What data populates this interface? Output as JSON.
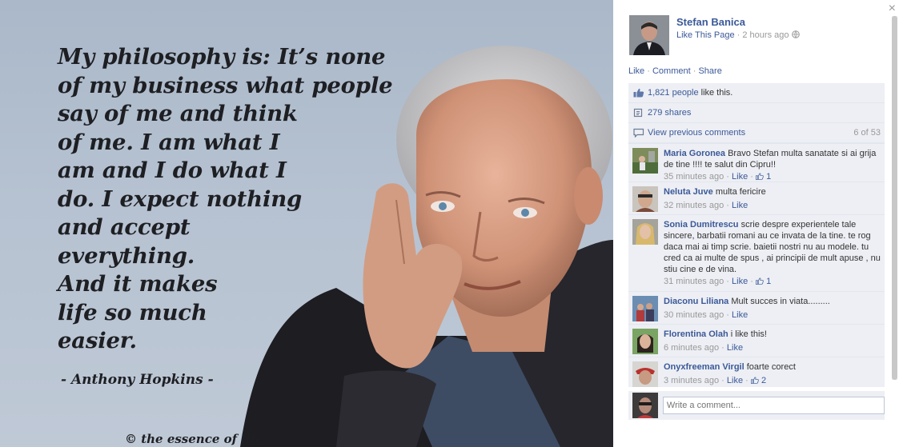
{
  "photo": {
    "quote_lines": [
      "My philosophy is: It’s none",
      "of my business what people",
      "say of me and think",
      "of me. I am what I",
      "am and I do what I",
      "do. I expect nothing",
      "and accept",
      "everything.",
      "And it makes",
      "life so much",
      "easier."
    ],
    "author": "- Anthony Hopkins -",
    "copyright": "© the essence of life"
  },
  "panel": {
    "close_glyph": "×",
    "page_name": "Stefan Banica",
    "like_page": "Like This Page",
    "separator": "·",
    "time": "2 hours ago",
    "actions": {
      "like": "Like",
      "comment": "Comment",
      "share": "Share"
    },
    "likes": {
      "link": "1,821 people",
      "rest": "like this."
    },
    "shares": "279 shares",
    "previous": {
      "label": "View previous comments",
      "count": "6 of 53"
    },
    "comments": [
      {
        "name": "Maria Goronea",
        "text": "Bravo Stefan multa sanatate si ai grija de tine !!!! te salut din Cipru!!",
        "time": "35 minutes ago",
        "like": "Like",
        "likes": "1"
      },
      {
        "name": "Neluta Juve",
        "text": "multa fericire",
        "time": "32 minutes ago",
        "like": "Like",
        "likes": ""
      },
      {
        "name": "Sonia Dumitrescu",
        "text": "scrie despre experientele tale sincere, barbatii romani au ce invata de la tine. te rog daca mai ai timp scrie. baietii nostri nu au modele. tu cred ca ai multe de spus , ai principii de mult apuse , nu stiu cine e de vina.",
        "time": "31 minutes ago",
        "like": "Like",
        "likes": "1"
      },
      {
        "name": "Diaconu Liliana",
        "text": "Mult succes in viata.........",
        "time": "30 minutes ago",
        "like": "Like",
        "likes": ""
      },
      {
        "name": "Florentina Olah",
        "text": "i like this!",
        "time": "6 minutes ago",
        "like": "Like",
        "likes": ""
      },
      {
        "name": "Onyxfreeman Virgil",
        "text": "foarte corect",
        "time": "3 minutes ago",
        "like": "Like",
        "likes": "2"
      }
    ],
    "write_placeholder": "Write a comment...",
    "colors": {
      "link": "#3b5998",
      "ufi_bg": "#edeff4",
      "meta": "#999999"
    }
  }
}
